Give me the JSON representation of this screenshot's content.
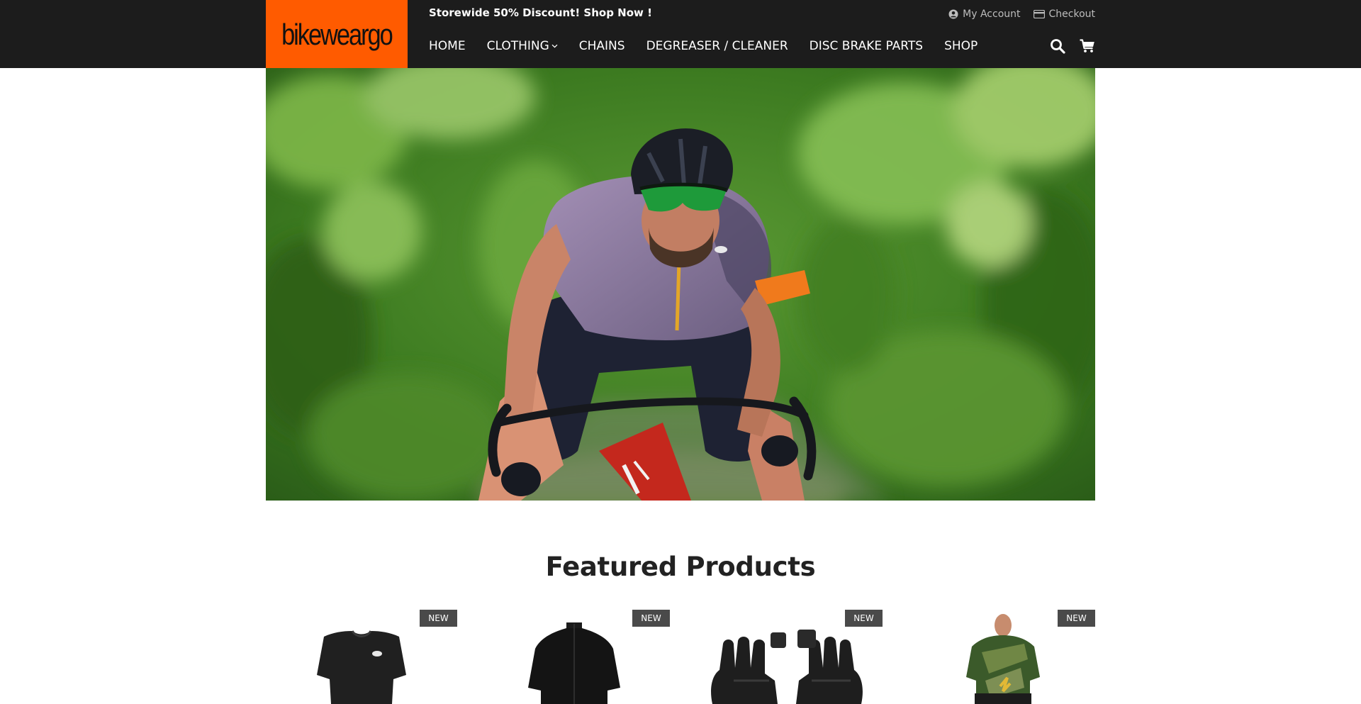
{
  "header": {
    "logo_text": "bikeweargo",
    "promo": "Storewide 50% Discount! Shop Now !",
    "top_links": {
      "account": "My Account",
      "checkout": "Checkout"
    },
    "nav": [
      {
        "label": "HOME"
      },
      {
        "label": "CLOTHING"
      },
      {
        "label": "CHAINS"
      },
      {
        "label": "DEGREASER / CLEANER"
      },
      {
        "label": "DISC BRAKE PARTS"
      },
      {
        "label": "SHOP"
      }
    ],
    "icons": {
      "search": "search-icon",
      "cart": "cart-icon",
      "dropdown": "chevron-down-icon",
      "account": "user-circle-icon",
      "checkout": "credit-card-icon"
    }
  },
  "hero": {
    "image": "cyclist-riding-road-bike"
  },
  "featured": {
    "title": "Featured Products",
    "products": [
      {
        "badge": "NEW",
        "image": "black-short-sleeve-tshirt"
      },
      {
        "badge": "NEW",
        "image": "black-cycling-jersey"
      },
      {
        "badge": "NEW",
        "image": "black-fingerless-gloves"
      },
      {
        "badge": "NEW",
        "image": "green-camo-cycling-jersey"
      }
    ]
  },
  "colors": {
    "brand_orange": "#ff5b00",
    "header_bg": "#1c1c1c",
    "badge_bg": "#4a4a4a"
  }
}
